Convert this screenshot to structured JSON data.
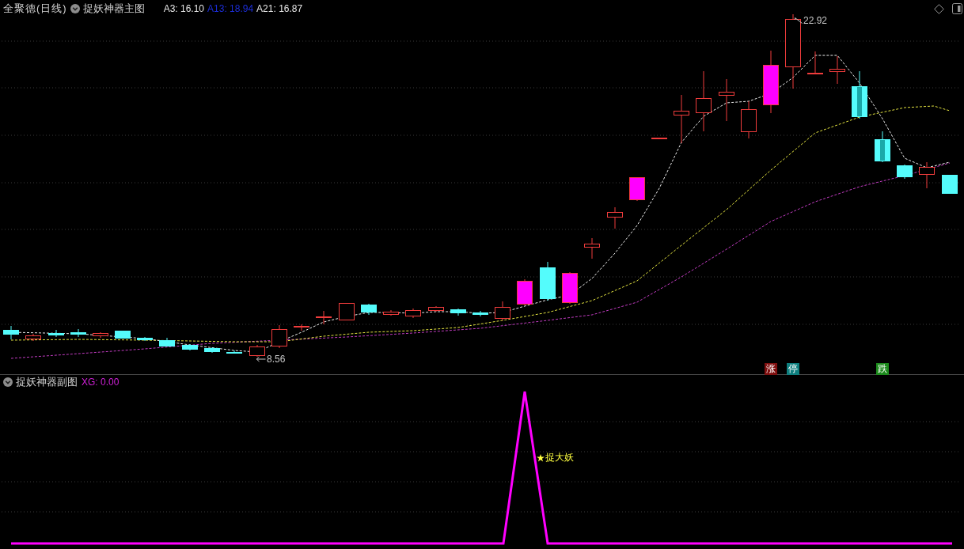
{
  "main_chart": {
    "stock_title": "全聚德(日线)",
    "indicator_name": "捉妖神器主图",
    "indicator_values": [
      {
        "text": "A3: 16.10",
        "color": "#e6e6e6"
      },
      {
        "text": "A13: 18.94",
        "color": "#1c2ed8"
      },
      {
        "text": "A21: 16.87",
        "color": "#e6e6e6"
      }
    ],
    "price_labels": [
      {
        "kind": "high",
        "text": "22.92"
      },
      {
        "kind": "low",
        "text": "8.56"
      }
    ],
    "signal_tags": [
      {
        "text": "涨",
        "color": "#7f1010"
      },
      {
        "text": "停",
        "color": "#0e7f7f"
      },
      {
        "text": "跌",
        "color": "#1c8a1c"
      }
    ]
  },
  "sub_chart": {
    "indicator_name": "捉妖神器副图",
    "value": "XG: 0.00",
    "signal_label": "捉大妖"
  }
}
